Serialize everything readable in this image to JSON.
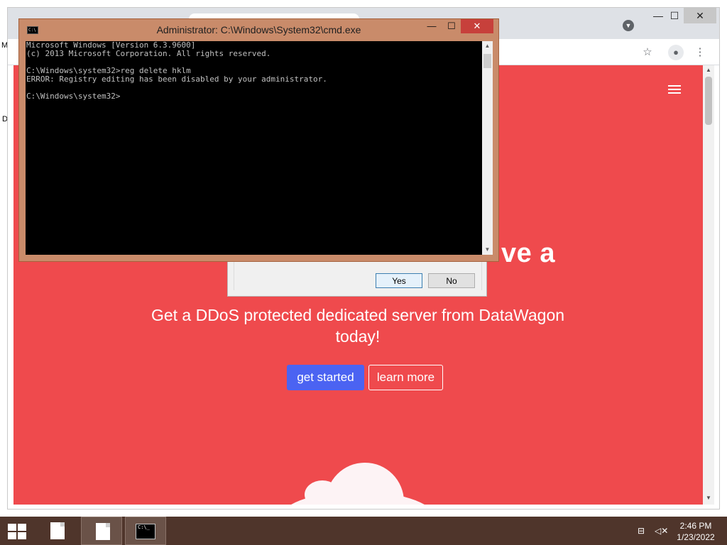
{
  "desktop": {
    "left_fragments": [
      "M",
      "D"
    ]
  },
  "browser": {
    "window_controls": {
      "minimize": "—",
      "maximize": "☐",
      "close": "✕"
    },
    "toolbar": {
      "bookmark_icon": "star-icon",
      "profile_icon": "profile-icon",
      "menu_icon": "menu-icon"
    },
    "page": {
      "hero_fragment": "ve a",
      "subtitle": "Get a DDoS protected dedicated server from DataWagon today!",
      "primary_button": "get started",
      "secondary_button": "learn more"
    }
  },
  "dialog": {
    "yes_label": "Yes",
    "no_label": "No"
  },
  "cmd": {
    "title": "Administrator: C:\\Windows\\System32\\cmd.exe",
    "lines": [
      "Microsoft Windows [Version 6.3.9600]",
      "(c) 2013 Microsoft Corporation. All rights reserved.",
      "",
      "C:\\Windows\\system32>reg delete hklm",
      "ERROR: Registry editing has been disabled by your administrator.",
      "",
      "C:\\Windows\\system32>"
    ],
    "controls": {
      "minimize": "—",
      "maximize": "☐",
      "close": "✕"
    }
  },
  "taskbar": {
    "apps": [
      "file-explorer",
      "file",
      "cmd"
    ],
    "clock": {
      "time": "2:46 PM",
      "date": "1/23/2022"
    },
    "colors": {
      "taskbar": "#4f352b",
      "page_accent": "#ef4a4d",
      "primary_button": "#4b63f2"
    }
  }
}
